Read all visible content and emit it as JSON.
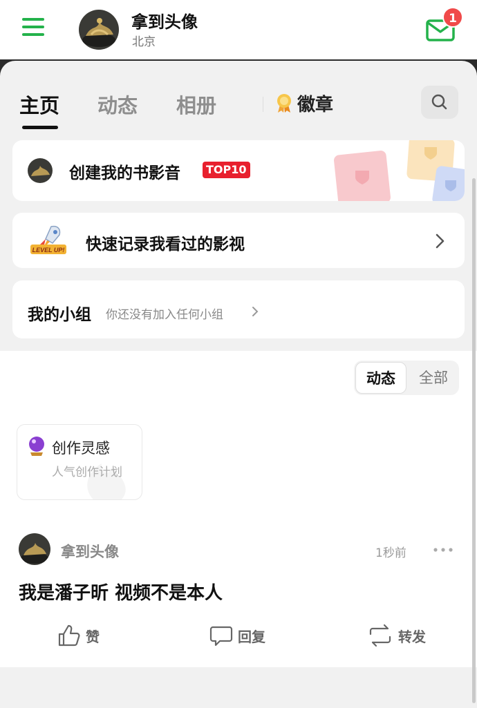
{
  "header": {
    "name": "拿到头像",
    "location": "北京",
    "mail_count": "1"
  },
  "tabs": [
    {
      "label": "主页",
      "active": true
    },
    {
      "label": "动态",
      "active": false
    },
    {
      "label": "相册",
      "active": false
    }
  ],
  "badge_tab": {
    "label": "徽章",
    "icon": "medal-icon"
  },
  "cards": {
    "create": {
      "text": "创建我的书影音",
      "tag": "TOP10"
    },
    "quick": {
      "text": "快速记录我看过的影视",
      "rocket_label": "LEVEL UP!"
    },
    "group": {
      "title": "我的小组",
      "subtitle": "你还没有加入任何小组"
    }
  },
  "filter": {
    "options": [
      "动态",
      "全部"
    ],
    "selected": "动态"
  },
  "inspiration": {
    "title": "创作灵感",
    "subtitle": "人气创作计划",
    "icon": "crystal-ball-icon"
  },
  "post": {
    "user": "拿到头像",
    "time": "1秒前",
    "text": "我是潘子昕 视频不是本人",
    "actions": {
      "like": "赞",
      "reply": "回复",
      "share": "转发"
    }
  },
  "colors": {
    "accent_green": "#24b24b",
    "badge_red": "#f04a4a",
    "top10_red": "#e8202e"
  }
}
